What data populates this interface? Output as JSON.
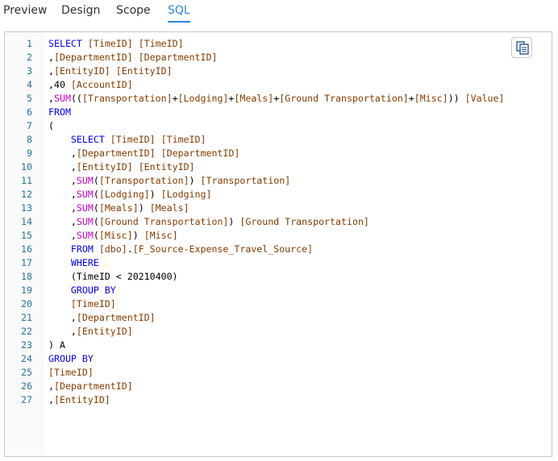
{
  "tabs": [
    {
      "label": "Preview",
      "active": false
    },
    {
      "label": "Design",
      "active": false
    },
    {
      "label": "Scope",
      "active": false
    },
    {
      "label": "SQL",
      "active": true
    }
  ],
  "colors": {
    "accent": "#2b88d8",
    "keyword": "#0000ff",
    "identifier": "#863b00",
    "function": "#c700c7",
    "line_number": "#237893"
  },
  "editor": {
    "copy_button_icon": "copy-icon",
    "lines": [
      {
        "n": "1",
        "tokens": [
          {
            "t": "kw",
            "v": "SELECT"
          },
          {
            "t": "pl",
            "v": " "
          },
          {
            "t": "id",
            "v": "[TimeID]"
          },
          {
            "t": "pl",
            "v": " "
          },
          {
            "t": "id",
            "v": "[TimeID]"
          }
        ]
      },
      {
        "n": "2",
        "tokens": [
          {
            "t": "pl",
            "v": ","
          },
          {
            "t": "id",
            "v": "[DepartmentID]"
          },
          {
            "t": "pl",
            "v": " "
          },
          {
            "t": "id",
            "v": "[DepartmentID]"
          }
        ]
      },
      {
        "n": "3",
        "tokens": [
          {
            "t": "pl",
            "v": ","
          },
          {
            "t": "id",
            "v": "[EntityID]"
          },
          {
            "t": "pl",
            "v": " "
          },
          {
            "t": "id",
            "v": "[EntityID]"
          }
        ]
      },
      {
        "n": "4",
        "tokens": [
          {
            "t": "pl",
            "v": ",40 "
          },
          {
            "t": "id",
            "v": "[AccountID]"
          }
        ]
      },
      {
        "n": "5",
        "tokens": [
          {
            "t": "pl",
            "v": ","
          },
          {
            "t": "fn",
            "v": "SUM"
          },
          {
            "t": "pl",
            "v": "(("
          },
          {
            "t": "id",
            "v": "[Transportation]"
          },
          {
            "t": "pl",
            "v": "+"
          },
          {
            "t": "id",
            "v": "[Lodging]"
          },
          {
            "t": "pl",
            "v": "+"
          },
          {
            "t": "id",
            "v": "[Meals]"
          },
          {
            "t": "pl",
            "v": "+"
          },
          {
            "t": "id",
            "v": "[Ground Transportation]"
          },
          {
            "t": "pl",
            "v": "+"
          },
          {
            "t": "id",
            "v": "[Misc]"
          },
          {
            "t": "pl",
            "v": ")) "
          },
          {
            "t": "id",
            "v": "[Value]"
          }
        ]
      },
      {
        "n": "6",
        "tokens": [
          {
            "t": "kw",
            "v": "FROM"
          }
        ]
      },
      {
        "n": "7",
        "tokens": [
          {
            "t": "pl",
            "v": "("
          }
        ]
      },
      {
        "n": "8",
        "tokens": [
          {
            "t": "pl",
            "v": "    "
          },
          {
            "t": "kw",
            "v": "SELECT"
          },
          {
            "t": "pl",
            "v": " "
          },
          {
            "t": "id",
            "v": "[TimeID]"
          },
          {
            "t": "pl",
            "v": " "
          },
          {
            "t": "id",
            "v": "[TimeID]"
          }
        ]
      },
      {
        "n": "9",
        "tokens": [
          {
            "t": "pl",
            "v": "    ,"
          },
          {
            "t": "id",
            "v": "[DepartmentID]"
          },
          {
            "t": "pl",
            "v": " "
          },
          {
            "t": "id",
            "v": "[DepartmentID]"
          }
        ]
      },
      {
        "n": "10",
        "tokens": [
          {
            "t": "pl",
            "v": "    ,"
          },
          {
            "t": "id",
            "v": "[EntityID]"
          },
          {
            "t": "pl",
            "v": " "
          },
          {
            "t": "id",
            "v": "[EntityID]"
          }
        ]
      },
      {
        "n": "11",
        "tokens": [
          {
            "t": "pl",
            "v": "    ,"
          },
          {
            "t": "fn",
            "v": "SUM"
          },
          {
            "t": "pl",
            "v": "("
          },
          {
            "t": "id",
            "v": "[Transportation]"
          },
          {
            "t": "pl",
            "v": ") "
          },
          {
            "t": "id",
            "v": "[Transportation]"
          }
        ]
      },
      {
        "n": "12",
        "tokens": [
          {
            "t": "pl",
            "v": "    ,"
          },
          {
            "t": "fn",
            "v": "SUM"
          },
          {
            "t": "pl",
            "v": "("
          },
          {
            "t": "id",
            "v": "[Lodging]"
          },
          {
            "t": "pl",
            "v": ") "
          },
          {
            "t": "id",
            "v": "[Lodging]"
          }
        ]
      },
      {
        "n": "13",
        "tokens": [
          {
            "t": "pl",
            "v": "    ,"
          },
          {
            "t": "fn",
            "v": "SUM"
          },
          {
            "t": "pl",
            "v": "("
          },
          {
            "t": "id",
            "v": "[Meals]"
          },
          {
            "t": "pl",
            "v": ") "
          },
          {
            "t": "id",
            "v": "[Meals]"
          }
        ]
      },
      {
        "n": "14",
        "tokens": [
          {
            "t": "pl",
            "v": "    ,"
          },
          {
            "t": "fn",
            "v": "SUM"
          },
          {
            "t": "pl",
            "v": "("
          },
          {
            "t": "id",
            "v": "[Ground Transportation]"
          },
          {
            "t": "pl",
            "v": ") "
          },
          {
            "t": "id",
            "v": "[Ground Transportation]"
          }
        ]
      },
      {
        "n": "15",
        "tokens": [
          {
            "t": "pl",
            "v": "    ,"
          },
          {
            "t": "fn",
            "v": "SUM"
          },
          {
            "t": "pl",
            "v": "("
          },
          {
            "t": "id",
            "v": "[Misc]"
          },
          {
            "t": "pl",
            "v": ") "
          },
          {
            "t": "id",
            "v": "[Misc]"
          }
        ]
      },
      {
        "n": "16",
        "tokens": [
          {
            "t": "pl",
            "v": "    "
          },
          {
            "t": "kw",
            "v": "FROM"
          },
          {
            "t": "pl",
            "v": " "
          },
          {
            "t": "id",
            "v": "[dbo]"
          },
          {
            "t": "pl",
            "v": "."
          },
          {
            "t": "id",
            "v": "[F_Source-Expense_Travel_Source]"
          }
        ]
      },
      {
        "n": "17",
        "tokens": [
          {
            "t": "pl",
            "v": "    "
          },
          {
            "t": "kw",
            "v": "WHERE"
          }
        ]
      },
      {
        "n": "18",
        "tokens": [
          {
            "t": "pl",
            "v": "    (TimeID < 20210400)"
          }
        ]
      },
      {
        "n": "19",
        "tokens": [
          {
            "t": "pl",
            "v": "    "
          },
          {
            "t": "kw",
            "v": "GROUP BY"
          }
        ]
      },
      {
        "n": "20",
        "tokens": [
          {
            "t": "pl",
            "v": "    "
          },
          {
            "t": "id",
            "v": "[TimeID]"
          }
        ]
      },
      {
        "n": "21",
        "tokens": [
          {
            "t": "pl",
            "v": "    ,"
          },
          {
            "t": "id",
            "v": "[DepartmentID]"
          }
        ]
      },
      {
        "n": "22",
        "tokens": [
          {
            "t": "pl",
            "v": "    ,"
          },
          {
            "t": "id",
            "v": "[EntityID]"
          }
        ]
      },
      {
        "n": "23",
        "tokens": [
          {
            "t": "pl",
            "v": ") A"
          }
        ]
      },
      {
        "n": "24",
        "tokens": [
          {
            "t": "kw",
            "v": "GROUP BY"
          }
        ]
      },
      {
        "n": "25",
        "tokens": [
          {
            "t": "id",
            "v": "[TimeID]"
          }
        ]
      },
      {
        "n": "26",
        "tokens": [
          {
            "t": "pl",
            "v": ","
          },
          {
            "t": "id",
            "v": "[DepartmentID]"
          }
        ]
      },
      {
        "n": "27",
        "tokens": [
          {
            "t": "pl",
            "v": ","
          },
          {
            "t": "id",
            "v": "[EntityID]"
          }
        ]
      }
    ]
  }
}
